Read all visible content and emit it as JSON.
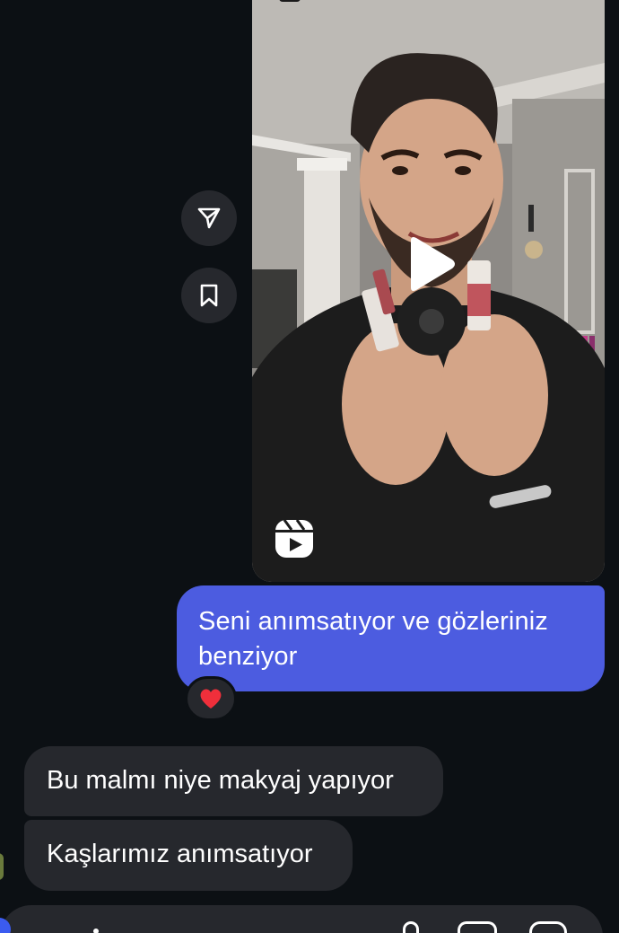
{
  "reel": {
    "play_icon": "play-icon",
    "reels_icon": "reels-icon",
    "subject": "man-holding-makeup-products"
  },
  "actions": {
    "share_icon": "paper-plane-icon",
    "save_icon": "bookmark-icon"
  },
  "messages": {
    "outgoing": {
      "text_line1": "Seni anımsatıyor ve gözleriniz",
      "text_line2": "benziyor",
      "reaction": "❤️"
    },
    "incoming": [
      {
        "text": "Bu malmı niye makyaj yapıyor"
      },
      {
        "text": "Kaşlarımız anımsatıyor"
      }
    ]
  },
  "composer": {
    "icons": [
      "camera-icon",
      "microphone-icon",
      "gallery-icon",
      "sticker-icon"
    ]
  },
  "colors": {
    "background": "#0c1014",
    "outgoing_bubble": "#4c5ce0",
    "incoming_bubble": "#26282d",
    "reaction_heart": "#ef2f3b"
  }
}
